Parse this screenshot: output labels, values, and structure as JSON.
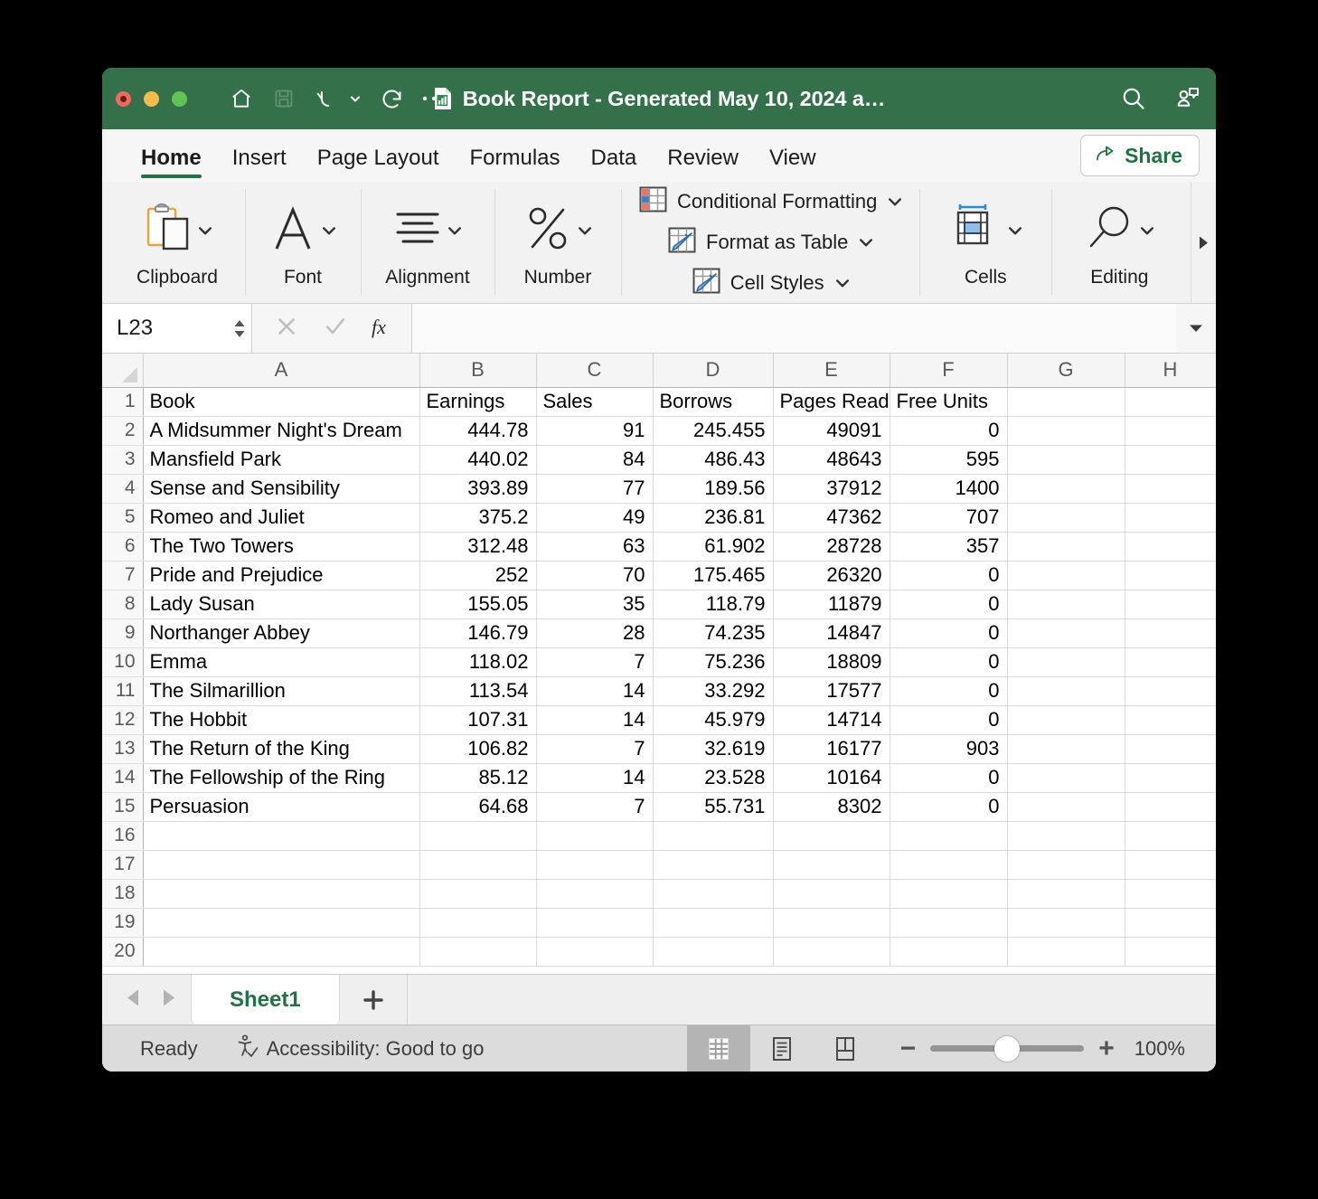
{
  "window": {
    "title": "Book Report - Generated May 10, 2024 a…",
    "doc_icon": "excel-document-icon"
  },
  "titlebar": {
    "traffic": [
      "close-button",
      "minimize-button",
      "maximize-button"
    ],
    "quick_access": [
      "home-icon",
      "save-icon",
      "undo-icon",
      "undo-dropdown-chevron",
      "redo-icon",
      "more-options-icon"
    ],
    "right_icons": [
      "search-icon",
      "collaborate-icon"
    ]
  },
  "ribbon": {
    "tabs": [
      {
        "label": "Home",
        "active": true
      },
      {
        "label": "Insert",
        "active": false
      },
      {
        "label": "Page Layout",
        "active": false
      },
      {
        "label": "Formulas",
        "active": false
      },
      {
        "label": "Data",
        "active": false
      },
      {
        "label": "Review",
        "active": false
      },
      {
        "label": "View",
        "active": false
      }
    ],
    "share_label": "Share",
    "groups": [
      {
        "label": "Clipboard",
        "icon": "clipboard-icon"
      },
      {
        "label": "Font",
        "icon": "font-icon"
      },
      {
        "label": "Alignment",
        "icon": "alignment-icon"
      },
      {
        "label": "Number",
        "icon": "percent-icon"
      }
    ],
    "styles": [
      {
        "label": "Conditional Formatting",
        "icon": "conditional-formatting-icon"
      },
      {
        "label": "Format as Table",
        "icon": "format-as-table-icon"
      },
      {
        "label": "Cell Styles",
        "icon": "cell-styles-icon"
      }
    ],
    "groups_right": [
      {
        "label": "Cells",
        "icon": "cells-icon"
      },
      {
        "label": "Editing",
        "icon": "editing-magnifier-icon"
      }
    ]
  },
  "formula_bar": {
    "name_box": "L23",
    "value": "",
    "cancel_icon": "cancel-x-icon",
    "confirm_icon": "confirm-check-icon",
    "function_icon": "fx-icon"
  },
  "sheet": {
    "columns": [
      "A",
      "B",
      "C",
      "D",
      "E",
      "F",
      "G",
      "H"
    ],
    "headers": [
      "Book",
      "Earnings",
      "Sales",
      "Borrows",
      "Pages Read",
      "Free Units"
    ],
    "rows": [
      {
        "n": 1,
        "cells": [
          "Book",
          "Earnings",
          "Sales",
          "Borrows",
          "Pages Read",
          "Free Units"
        ],
        "header": true
      },
      {
        "n": 2,
        "cells": [
          "A Midsummer Night's Dream",
          "444.78",
          "91",
          "245.455",
          "49091",
          "0"
        ]
      },
      {
        "n": 3,
        "cells": [
          "Mansfield Park",
          "440.02",
          "84",
          "486.43",
          "48643",
          "595"
        ]
      },
      {
        "n": 4,
        "cells": [
          "Sense and Sensibility",
          "393.89",
          "77",
          "189.56",
          "37912",
          "1400"
        ]
      },
      {
        "n": 5,
        "cells": [
          "Romeo and Juliet",
          "375.2",
          "49",
          "236.81",
          "47362",
          "707"
        ]
      },
      {
        "n": 6,
        "cells": [
          "The Two Towers",
          "312.48",
          "63",
          "61.902",
          "28728",
          "357"
        ]
      },
      {
        "n": 7,
        "cells": [
          "Pride and Prejudice",
          "252",
          "70",
          "175.465",
          "26320",
          "0"
        ]
      },
      {
        "n": 8,
        "cells": [
          "Lady Susan",
          "155.05",
          "35",
          "118.79",
          "11879",
          "0"
        ]
      },
      {
        "n": 9,
        "cells": [
          "Northanger Abbey",
          "146.79",
          "28",
          "74.235",
          "14847",
          "0"
        ]
      },
      {
        "n": 10,
        "cells": [
          "Emma",
          "118.02",
          "7",
          "75.236",
          "18809",
          "0"
        ]
      },
      {
        "n": 11,
        "cells": [
          "The Silmarillion",
          "113.54",
          "14",
          "33.292",
          "17577",
          "0"
        ]
      },
      {
        "n": 12,
        "cells": [
          "The Hobbit",
          "107.31",
          "14",
          "45.979",
          "14714",
          "0"
        ]
      },
      {
        "n": 13,
        "cells": [
          "The Return of the King",
          "106.82",
          "7",
          "32.619",
          "16177",
          "903"
        ]
      },
      {
        "n": 14,
        "cells": [
          "The Fellowship of the Ring",
          "85.12",
          "14",
          "23.528",
          "10164",
          "0"
        ]
      },
      {
        "n": 15,
        "cells": [
          "Persuasion",
          "64.68",
          "7",
          "55.731",
          "8302",
          "0"
        ]
      },
      {
        "n": 16,
        "cells": [
          "",
          "",
          "",
          "",
          "",
          ""
        ]
      },
      {
        "n": 17,
        "cells": [
          "",
          "",
          "",
          "",
          "",
          ""
        ]
      },
      {
        "n": 18,
        "cells": [
          "",
          "",
          "",
          "",
          "",
          ""
        ]
      },
      {
        "n": 19,
        "cells": [
          "",
          "",
          "",
          "",
          "",
          ""
        ]
      },
      {
        "n": 20,
        "cells": [
          "",
          "",
          "",
          "",
          "",
          ""
        ]
      }
    ]
  },
  "chart_data": {
    "type": "table",
    "title": "Book Report",
    "columns": [
      "Book",
      "Earnings",
      "Sales",
      "Borrows",
      "Pages Read",
      "Free Units"
    ],
    "rows": [
      [
        "A Midsummer Night's Dream",
        444.78,
        91,
        245.455,
        49091,
        0
      ],
      [
        "Mansfield Park",
        440.02,
        84,
        486.43,
        48643,
        595
      ],
      [
        "Sense and Sensibility",
        393.89,
        77,
        189.56,
        37912,
        1400
      ],
      [
        "Romeo and Juliet",
        375.2,
        49,
        236.81,
        47362,
        707
      ],
      [
        "The Two Towers",
        312.48,
        63,
        61.902,
        28728,
        357
      ],
      [
        "Pride and Prejudice",
        252,
        70,
        175.465,
        26320,
        0
      ],
      [
        "Lady Susan",
        155.05,
        35,
        118.79,
        11879,
        0
      ],
      [
        "Northanger Abbey",
        146.79,
        28,
        74.235,
        14847,
        0
      ],
      [
        "Emma",
        118.02,
        7,
        75.236,
        18809,
        0
      ],
      [
        "The Silmarillion",
        113.54,
        14,
        33.292,
        17577,
        0
      ],
      [
        "The Hobbit",
        107.31,
        14,
        45.979,
        14714,
        0
      ],
      [
        "The Return of the King",
        106.82,
        7,
        32.619,
        16177,
        903
      ],
      [
        "The Fellowship of the Ring",
        85.12,
        14,
        23.528,
        10164,
        0
      ],
      [
        "Persuasion",
        64.68,
        7,
        55.731,
        8302,
        0
      ]
    ]
  },
  "sheet_tabs": {
    "prev_icon": "prev-sheet-arrow-icon",
    "next_icon": "next-sheet-arrow-icon",
    "tabs": [
      {
        "label": "Sheet1",
        "active": true
      }
    ],
    "add_label": "+"
  },
  "status_bar": {
    "ready": "Ready",
    "accessibility": "Accessibility: Good to go",
    "views": [
      "normal-view-icon",
      "page-layout-view-icon",
      "page-break-view-icon"
    ],
    "zoom_out": "−",
    "zoom_in": "+",
    "zoom_level": "100%"
  },
  "colors": {
    "titlebar": "#34714a",
    "accent_green": "#217346",
    "ribbon_bg": "#f2f2f2",
    "status_bg": "#dcdcdc"
  }
}
